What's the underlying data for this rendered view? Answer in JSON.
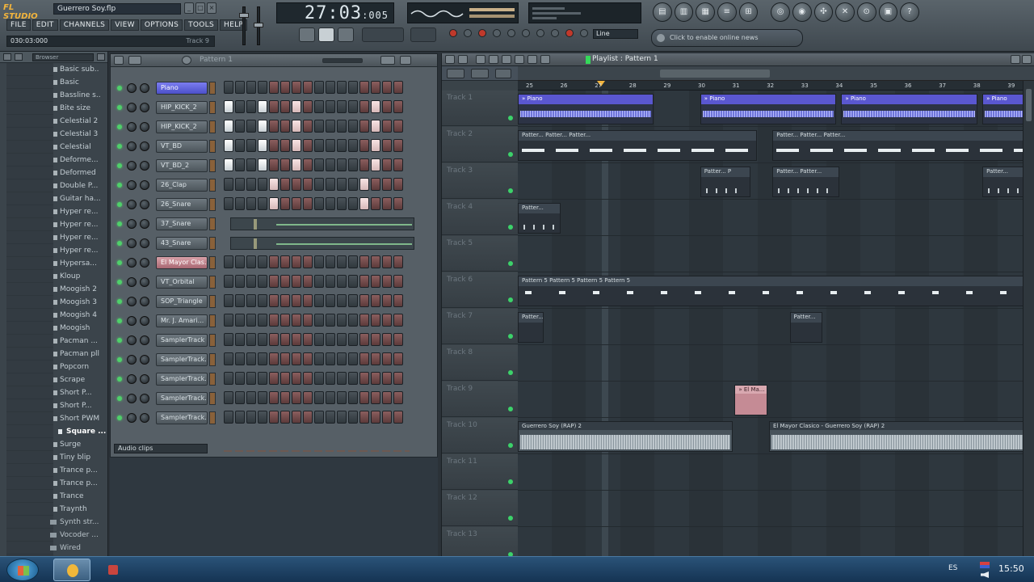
{
  "app": {
    "logo": "FL STUDIO",
    "project_title": "Guerrero Soy.flp",
    "menu": [
      "FILE",
      "EDIT",
      "CHANNELS",
      "VIEW",
      "OPTIONS",
      "TOOLS",
      "HELP"
    ],
    "hint": "030:03:000",
    "hint_right": "Track 9",
    "time_main": "27:03",
    "time_sub": ":005",
    "line_mode": "Line",
    "online_text": "Click to enable online news",
    "window_buttons": [
      "_",
      "□",
      "×"
    ],
    "toolbar_icons": [
      "playlist-icon",
      "stepseq-icon",
      "piano-roll-icon",
      "browser-icon",
      "mixer-icon",
      "plugin-icon",
      "help-icon",
      "cpu-icon",
      "render-icon",
      "capture-icon",
      "info-icon",
      "question-icon"
    ]
  },
  "browser": {
    "selector": "Browser",
    "items": [
      {
        "label": "Basic sub..",
        "type": "file"
      },
      {
        "label": "Basic",
        "type": "file"
      },
      {
        "label": "Bassline s..",
        "type": "file"
      },
      {
        "label": "Bite size",
        "type": "file"
      },
      {
        "label": "Celestial 2",
        "type": "file"
      },
      {
        "label": "Celestial 3",
        "type": "file"
      },
      {
        "label": "Celestial",
        "type": "file"
      },
      {
        "label": "Deforme...",
        "type": "file"
      },
      {
        "label": "Deformed",
        "type": "file"
      },
      {
        "label": "Double P...",
        "type": "file"
      },
      {
        "label": "Guitar ha...",
        "type": "file"
      },
      {
        "label": "Hyper re...",
        "type": "file"
      },
      {
        "label": "Hyper re...",
        "type": "file"
      },
      {
        "label": "Hyper re...",
        "type": "file"
      },
      {
        "label": "Hyper re...",
        "type": "file"
      },
      {
        "label": "Hypersa...",
        "type": "file"
      },
      {
        "label": "Kloup",
        "type": "file"
      },
      {
        "label": "Moogish 2",
        "type": "file"
      },
      {
        "label": "Moogish 3",
        "type": "file"
      },
      {
        "label": "Moogish 4",
        "type": "file"
      },
      {
        "label": "Moogish",
        "type": "file"
      },
      {
        "label": "Pacman ...",
        "type": "file"
      },
      {
        "label": "Pacman pll",
        "type": "file"
      },
      {
        "label": "Popcorn",
        "type": "file"
      },
      {
        "label": "Scrape",
        "type": "file"
      },
      {
        "label": "Short P...",
        "type": "file"
      },
      {
        "label": "Short P...",
        "type": "file"
      },
      {
        "label": "Short PWM",
        "type": "file"
      },
      {
        "label": "Square ...",
        "type": "active"
      },
      {
        "label": "Surge",
        "type": "file"
      },
      {
        "label": "Tiny blip",
        "type": "file"
      },
      {
        "label": "Trance p...",
        "type": "file"
      },
      {
        "label": "Trance p...",
        "type": "file"
      },
      {
        "label": "Trance",
        "type": "file"
      },
      {
        "label": "Traynth",
        "type": "file"
      },
      {
        "label": "Synth str...",
        "type": "folder"
      },
      {
        "label": "Vocoder ...",
        "type": "folder"
      },
      {
        "label": "Wired",
        "type": "folder"
      }
    ]
  },
  "stepseq": {
    "title": "Pattern 1",
    "audio_clips_label": "Audio clips",
    "channels": [
      {
        "name": "Piano",
        "style": "sel",
        "kind": "steps",
        "on": []
      },
      {
        "name": "HIP_KICK_2",
        "style": "",
        "kind": "steps",
        "on": [
          0,
          3,
          6,
          13
        ]
      },
      {
        "name": "HIP_KICK_2",
        "style": "",
        "kind": "steps",
        "on": [
          0,
          3,
          6,
          13
        ]
      },
      {
        "name": "VT_BD",
        "style": "",
        "kind": "steps",
        "on": [
          0,
          3,
          6,
          13
        ]
      },
      {
        "name": "VT_BD_2",
        "style": "",
        "kind": "steps",
        "on": [
          0,
          3,
          6,
          13
        ]
      },
      {
        "name": "26_Clap",
        "style": "",
        "kind": "steps",
        "on": [
          4,
          12
        ]
      },
      {
        "name": "26_Snare",
        "style": "",
        "kind": "steps",
        "on": [
          4,
          12
        ]
      },
      {
        "name": "37_Snare",
        "style": "",
        "kind": "audio",
        "on": []
      },
      {
        "name": "43_Snare",
        "style": "",
        "kind": "audio",
        "on": []
      },
      {
        "name": "El Mayor Clas...",
        "style": "pink",
        "kind": "steps",
        "on": []
      },
      {
        "name": "VT_Orbital",
        "style": "",
        "kind": "steps",
        "on": []
      },
      {
        "name": "SOP_Triangle",
        "style": "",
        "kind": "steps",
        "on": []
      },
      {
        "name": "Mr. J. Amari...",
        "style": "",
        "kind": "steps",
        "on": []
      },
      {
        "name": "SamplerTrack",
        "style": "",
        "kind": "steps",
        "on": []
      },
      {
        "name": "SamplerTrack...",
        "style": "",
        "kind": "steps",
        "on": []
      },
      {
        "name": "SamplerTrack...",
        "style": "",
        "kind": "steps",
        "on": []
      },
      {
        "name": "SamplerTrack...",
        "style": "",
        "kind": "steps",
        "on": []
      },
      {
        "name": "SamplerTrack...",
        "style": "",
        "kind": "steps",
        "on": []
      }
    ]
  },
  "playlist": {
    "title": "Playlist : Pattern 1",
    "bars": [
      "25",
      "26",
      "27",
      "28",
      "29",
      "30",
      "31",
      "32",
      "33",
      "34",
      "35",
      "36",
      "37",
      "38",
      "39"
    ],
    "tracks": [
      "Track 1",
      "Track 2",
      "Track 3",
      "Track 4",
      "Track 5",
      "Track 6",
      "Track 7",
      "Track 8",
      "Track 9",
      "Track 10",
      "Track 11",
      "Track 12",
      "Track 13"
    ],
    "clips": [
      {
        "lane": 0,
        "start": 0,
        "len": 4,
        "label": "» Piano",
        "style": "purple",
        "fill": "purplewave"
      },
      {
        "lane": 0,
        "start": 5.3,
        "len": 4,
        "label": "» Piano",
        "style": "purple",
        "fill": "purplewave"
      },
      {
        "lane": 0,
        "start": 9.4,
        "len": 4,
        "label": "» Piano",
        "style": "purple",
        "fill": "purplewave"
      },
      {
        "lane": 0,
        "start": 13.5,
        "len": 1.5,
        "label": "» Piano",
        "style": "purple",
        "fill": "purplewave"
      },
      {
        "lane": 1,
        "start": 0,
        "len": 7,
        "label": "Patter... Patter... Patter...",
        "style": "dark",
        "fill": "notes"
      },
      {
        "lane": 1,
        "start": 7.4,
        "len": 7.6,
        "label": "Patter... Patter... Patter...",
        "style": "dark",
        "fill": "notes"
      },
      {
        "lane": 2,
        "start": 5.3,
        "len": 1.5,
        "label": "Patter... P",
        "style": "dark",
        "fill": "tinynotes"
      },
      {
        "lane": 2,
        "start": 7.4,
        "len": 2,
        "label": "Patter... Patter...",
        "style": "dark",
        "fill": "tinynotes"
      },
      {
        "lane": 2,
        "start": 13.5,
        "len": 1.5,
        "label": "Patter...",
        "style": "dark",
        "fill": "tinynotes"
      },
      {
        "lane": 3,
        "start": 0,
        "len": 1.3,
        "label": "Patter...",
        "style": "dark",
        "fill": "tinynotes"
      },
      {
        "lane": 5,
        "start": 0,
        "len": 15,
        "label": "Pattern 5   Pattern 5   Pattern 5   Pattern 5",
        "style": "dark",
        "fill": "bigdots"
      },
      {
        "lane": 6,
        "start": 0,
        "len": 0.8,
        "label": "Patter...",
        "style": "dark",
        "fill": ""
      },
      {
        "lane": 6,
        "start": 7.9,
        "len": 1,
        "label": "Patter...",
        "style": "dark",
        "fill": ""
      },
      {
        "lane": 8,
        "start": 6.3,
        "len": 1,
        "label": "» El Ma...",
        "style": "pink",
        "fill": ""
      },
      {
        "lane": 9,
        "start": 0,
        "len": 6.3,
        "label": "Guerrero Soy (RAP) 2",
        "style": "audio",
        "fill": "wavefill"
      },
      {
        "lane": 9,
        "start": 7.3,
        "len": 7.7,
        "label": "El Mayor Clasico - Guerrero Soy (RAP) 2",
        "style": "audio",
        "fill": "wavefill"
      }
    ]
  },
  "taskbar": {
    "language": "ES",
    "clock": "15:50"
  },
  "colors": {
    "accent": "#f2b43c",
    "selected_channel": "#5a57d0",
    "led": "#4fd06a"
  }
}
